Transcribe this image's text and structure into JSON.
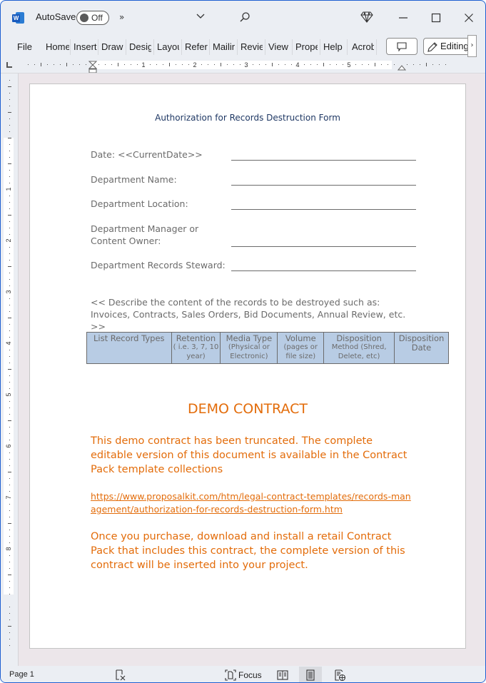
{
  "titlebar": {
    "app_icon": "word-icon",
    "app_letter": "W",
    "autosave_label": "AutoSave",
    "autosave_state": "Off",
    "more_commands": "»",
    "icons": [
      "word-icon",
      "more-commands-icon",
      "customize-qat-chevron-icon",
      "search-icon",
      "premium-diamond-icon",
      "minimize-icon",
      "maximize-icon",
      "close-icon"
    ]
  },
  "ribbon": {
    "tabs": [
      {
        "label": "File"
      },
      {
        "label": "Home"
      },
      {
        "label": "Insert"
      },
      {
        "label": "Draw"
      },
      {
        "label": "Design"
      },
      {
        "label": "Layout"
      },
      {
        "label": "References"
      },
      {
        "label": "Mailings"
      },
      {
        "label": "Review"
      },
      {
        "label": "View"
      },
      {
        "label": "Properties"
      },
      {
        "label": "Help"
      },
      {
        "label": "Acrobat"
      }
    ],
    "comments_icon": "comment-icon",
    "editing_label": "Editing",
    "editing_icon": "pencil-icon",
    "scroll_right": "›"
  },
  "ruler": {
    "horizontal_numbers": [
      "1",
      "2",
      "3",
      "4",
      "5"
    ],
    "vertical_numbers": [
      "1",
      "2",
      "3",
      "4",
      "5",
      "6",
      "7",
      "8"
    ]
  },
  "document": {
    "title": "Authorization for Records Destruction Form",
    "fields": [
      {
        "label": "Date: <<CurrentDate>>"
      },
      {
        "label": "Department Name:"
      },
      {
        "label": "Department Location:"
      },
      {
        "label": "Department Manager or\nContent Owner:",
        "line1": "Department Manager or",
        "line2": "Content Owner:"
      },
      {
        "label": "Department Records Steward:"
      }
    ],
    "describe_text": "<< Describe the content of the records to be destroyed such as: Invoices, Contracts, Sales Orders, Bid Documents, Annual Review, etc. >>",
    "table": {
      "header_color": "#b8cce4",
      "columns": [
        {
          "title": "List Record Types",
          "sub": ""
        },
        {
          "title": "Retention",
          "sub": "( i.e. 3, 7, 10 year)"
        },
        {
          "title": "Media Type",
          "sub": "(Physical or Electronic)"
        },
        {
          "title": "Volume",
          "sub": "(pages or file size)"
        },
        {
          "title": "Disposition",
          "sub": "Method (Shred, Delete, etc)"
        },
        {
          "title": "Disposition Date",
          "sub": ""
        }
      ]
    },
    "demo": {
      "title": "DEMO CONTRACT",
      "paragraph1": "This demo contract has been truncated. The complete editable version of this document is available in the Contract Pack template collections",
      "link": "https://www.proposalkit.com/htm/legal-contract-templates/records-management/authorization-for-records-destruction-form.htm",
      "paragraph2": "Once you purchase, download and install a retail Contract Pack that includes this contract, the complete version of this contract will be inserted into your project.",
      "accent_color": "#e36c0a"
    }
  },
  "statusbar": {
    "page_label": "Page 1",
    "focus_label": "Focus",
    "icons": [
      "proofing-icon",
      "focus-icon",
      "read-mode-icon",
      "print-layout-icon",
      "web-layout-icon"
    ],
    "active_view": "print-layout"
  }
}
